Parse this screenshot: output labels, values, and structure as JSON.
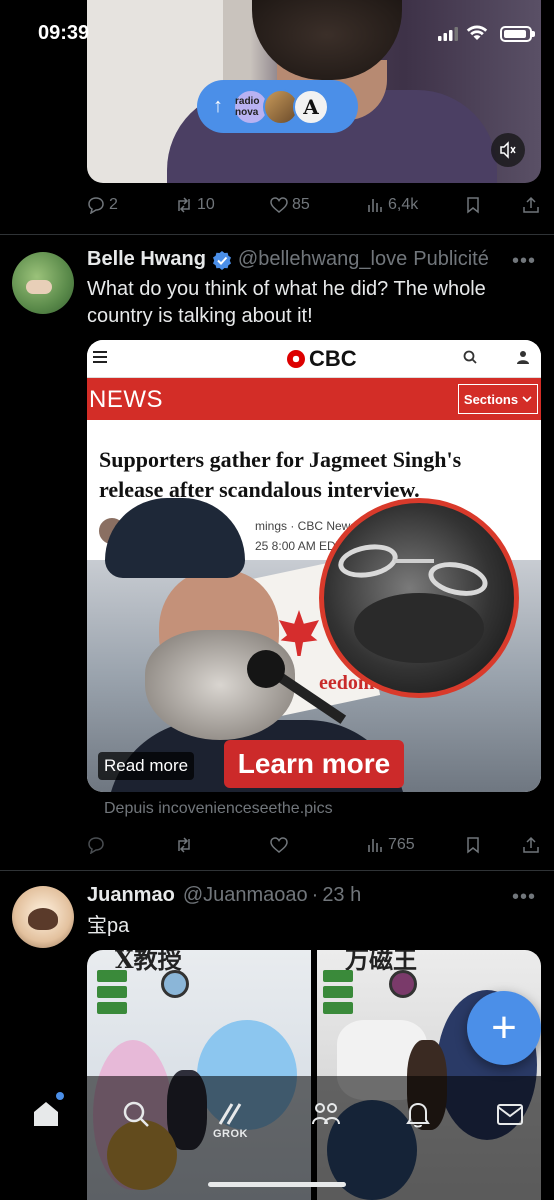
{
  "status_bar": {
    "time": "09:39"
  },
  "top_tweet": {
    "pill": {
      "arrow": "↑",
      "avatar_1": "radio nova",
      "avatar_3": "A"
    },
    "actions": {
      "replies": "2",
      "reposts": "10",
      "likes": "85",
      "views": "6,4k"
    }
  },
  "ad_tweet": {
    "name": "Belle Hwang",
    "handle": "@bellehwang_love",
    "promoted": "Publicité",
    "more": "•••",
    "text": "What do you think of what he did? The whole country is talking about it!",
    "card": {
      "site_logo": "CBC",
      "section_label": "NEWS",
      "sections_button": "Sections",
      "headline": "Supporters gather for Jagmeet Singh's release after scandalous interview.",
      "byline_1": "mings · CBC News ·",
      "byline_2": "25 8:00 AM EDT | L",
      "photo_sign": "eedom",
      "read_more": "Read more",
      "cta": "Learn more"
    },
    "source": "Depuis incoveniencеseethe.pics",
    "actions": {
      "views": "765"
    }
  },
  "juan_tweet": {
    "name": "Juanmao",
    "handle": "@Juanmaoao",
    "time": "23 h",
    "more": "•••",
    "text": "宝pa",
    "img_left_title": "X教授",
    "img_right_title": "万磁王"
  },
  "fab": {
    "label": "+"
  },
  "bottom_nav": {
    "grok_label": "GROK"
  },
  "colors": {
    "accent": "#4b8fe8",
    "muted": "#71767b",
    "cbc_red": "#d32d27",
    "background": "#000000"
  }
}
